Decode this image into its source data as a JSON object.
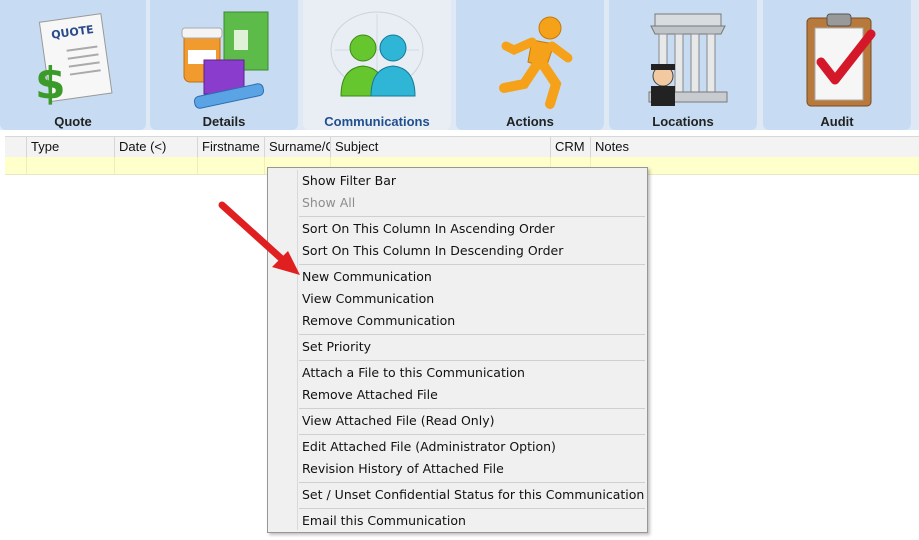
{
  "tabs": [
    {
      "label": "Quote",
      "icon": "quote-icon"
    },
    {
      "label": "Details",
      "icon": "details-icon"
    },
    {
      "label": "Communications",
      "icon": "communications-icon",
      "active": true
    },
    {
      "label": "Actions",
      "icon": "actions-icon"
    },
    {
      "label": "Locations",
      "icon": "locations-icon"
    },
    {
      "label": "Audit",
      "icon": "audit-icon"
    }
  ],
  "columns": [
    "Type",
    "Date (<)",
    "Firstname",
    "Surname/C",
    "Subject",
    "CRM",
    "Notes"
  ],
  "menu": {
    "items": [
      {
        "label": "Show Filter Bar"
      },
      {
        "label": "Show All",
        "disabled": true
      },
      {
        "label": "Sort On This Column In Ascending Order"
      },
      {
        "label": "Sort On This Column In Descending Order"
      },
      {
        "label": "New Communication"
      },
      {
        "label": "View Communication"
      },
      {
        "label": "Remove Communication"
      },
      {
        "label": "Set Priority"
      },
      {
        "label": "Attach a File to this Communication"
      },
      {
        "label": "Remove Attached File"
      },
      {
        "label": "View Attached File (Read Only)"
      },
      {
        "label": "Edit Attached File (Administrator Option)"
      },
      {
        "label": "Revision History of Attached File"
      },
      {
        "label": "Set / Unset Confidential Status for this Communication"
      },
      {
        "label": "Email this Communication"
      }
    ]
  },
  "colors": {
    "accent": "#1f4f8f",
    "filter_row": "#ffffcc",
    "arrow": "#e02020"
  }
}
